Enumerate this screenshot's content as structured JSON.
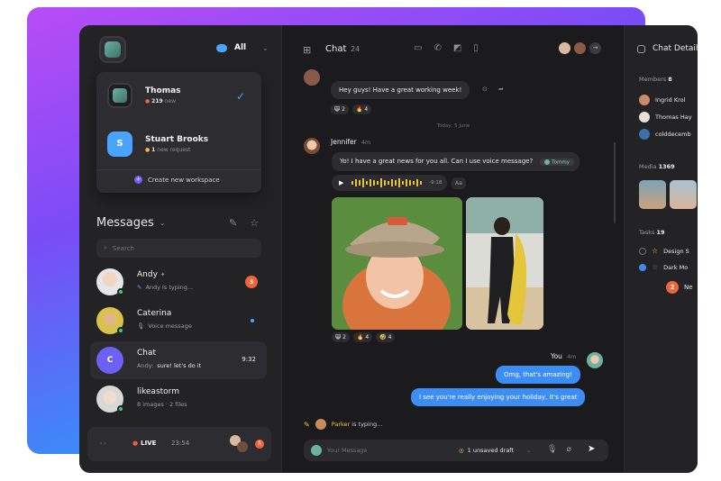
{
  "workspace": {
    "filter_label": "All",
    "items": [
      {
        "name": "Thomas",
        "count": "219",
        "sub": "new"
      },
      {
        "name": "Stuart Brooks",
        "initial": "S",
        "count": "1",
        "sub": "new request"
      }
    ],
    "create_label": "Create new workspace"
  },
  "messages": {
    "title": "Messages",
    "search_placeholder": "Search",
    "conversations": [
      {
        "name": "Andy",
        "sub": "Andy is typing...",
        "badge": "3"
      },
      {
        "name": "Caterina",
        "sub": "Voice message"
      },
      {
        "name": "Chat",
        "initial": "C",
        "sub_prefix": "Andy:",
        "sub": "sure! let's do it",
        "time": "9:32"
      },
      {
        "name": "likeastorm",
        "sub": "8 images · 2 files"
      }
    ],
    "live": {
      "label": "LIVE",
      "time": "23:54",
      "badge": "5"
    }
  },
  "chat": {
    "title": "Chat",
    "count": "24",
    "date_separator": "Today, 5 June",
    "first_message": {
      "text": "Hey guys! Have a great working week!",
      "reactions": [
        "😸 2",
        "🔥 4"
      ]
    },
    "jennifer": {
      "name": "Jennifer",
      "time": "4m",
      "text": "Yo! I have a great news for you all. Can I use voice message?",
      "mention": "Tommy",
      "voice_duration": "-9:18",
      "speed": "Aa",
      "photo_reactions": [
        "😸 2",
        "🔥 4",
        "🤣 4"
      ]
    },
    "you": {
      "name": "You",
      "time": "4m",
      "messages": [
        "Omg, that's amazing!",
        "I see you're really enjoying your holiday, it's great"
      ]
    },
    "typing": {
      "name": "Parker",
      "text": "is typing..."
    },
    "composer": {
      "placeholder": "Your Message",
      "draft": "1 unsaved draft"
    }
  },
  "details": {
    "title": "Chat Details",
    "members_label": "Members",
    "members_count": "8",
    "members": [
      "Ingrid Krol",
      "Thomas Hay",
      "colddecemb"
    ],
    "media_label": "Media",
    "media_count": "1369",
    "tasks_label": "Tasks",
    "tasks_count": "19",
    "tasks": [
      "Design S",
      "Dark Mo"
    ],
    "badge": "2",
    "badge_text": "Ne"
  },
  "colors": {
    "accent": "#3d8ef4",
    "badge": "#f0643c",
    "online": "#3ccb7f",
    "highlight": "#e8c13c"
  }
}
